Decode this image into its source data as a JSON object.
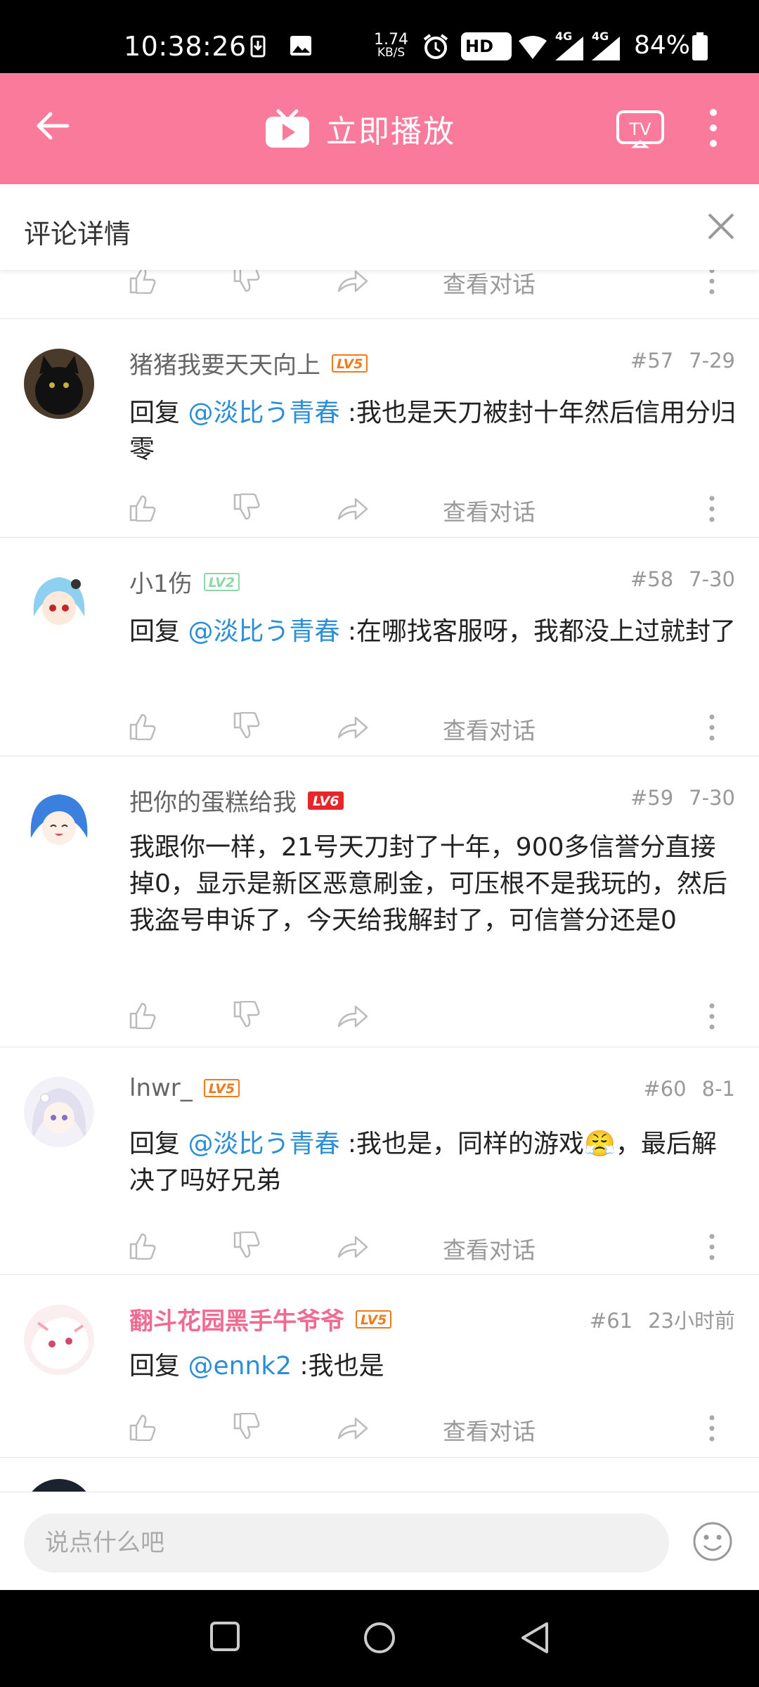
{
  "status_bar": {
    "time": "10:38:26",
    "net_speed_value": "1.74",
    "net_speed_unit": "KB/S",
    "hd_label": "HD",
    "signal_4g_1": "4G",
    "signal_4g_2": "4G",
    "battery": "84%"
  },
  "app_bar": {
    "title": "立即播放",
    "back_icon": "arrow-left",
    "tv_icon": "tv",
    "more_icon": "vertical-ellipsis",
    "tv_label": "TV",
    "color": "#f97a9a"
  },
  "sheet": {
    "title": "评论详情",
    "close_icon": "x"
  },
  "comments": [
    {
      "user": "猪猪我要天天向上",
      "level": "LV5",
      "level_color": "#f07b1d",
      "floor": "#57",
      "date": "7-29",
      "reply_prefix": "回复 ",
      "mention": "@淡比う青春",
      "text": " :我也是天刀被封十年然后信用分归零",
      "view_conversation": "查看对话"
    },
    {
      "user": "小1伤",
      "level": "LV2",
      "level_color": "#8fd6a8",
      "floor": "#58",
      "date": "7-30",
      "reply_prefix": "回复 ",
      "mention": "@淡比う青春",
      "text": " :在哪找客服呀，我都没上过就封了",
      "view_conversation": "查看对话"
    },
    {
      "user": "把你的蛋糕给我",
      "level": "LV6",
      "level_color": "#e8262a",
      "floor": "#59",
      "date": "7-30",
      "reply_prefix": "",
      "mention": "",
      "text": "我跟你一样，21号天刀封了十年，900多信誉分直接掉0，显示是新区恶意刷金，可压根不是我玩的，然后我盗号申诉了，今天给我解封了，可信誉分还是0",
      "view_conversation": ""
    },
    {
      "user": "lnwr_",
      "level": "LV5",
      "level_color": "#f07b1d",
      "floor": "#60",
      "date": "8-1",
      "reply_prefix": "回复 ",
      "mention": "@淡比う青春",
      "text": " :我也是，同样的游戏😤，最后解决了吗好兄弟",
      "view_conversation": "查看对话"
    },
    {
      "user": "翻斗花园黑手牛爷爷",
      "level": "LV5",
      "level_color": "#f07b1d",
      "floor": "#61",
      "date": "23小时前",
      "reply_prefix": "回复 ",
      "mention": "@ennk2",
      "text": " :我也是",
      "view_conversation": "查看对话"
    }
  ],
  "top_partial_actions": {
    "view_conversation": "查看对话"
  },
  "input_bar": {
    "placeholder": "说点什么吧",
    "emoji_icon": "smiley-face"
  },
  "nav_bar": {
    "icons": [
      "recents-square",
      "home-circle",
      "back-triangle"
    ]
  }
}
